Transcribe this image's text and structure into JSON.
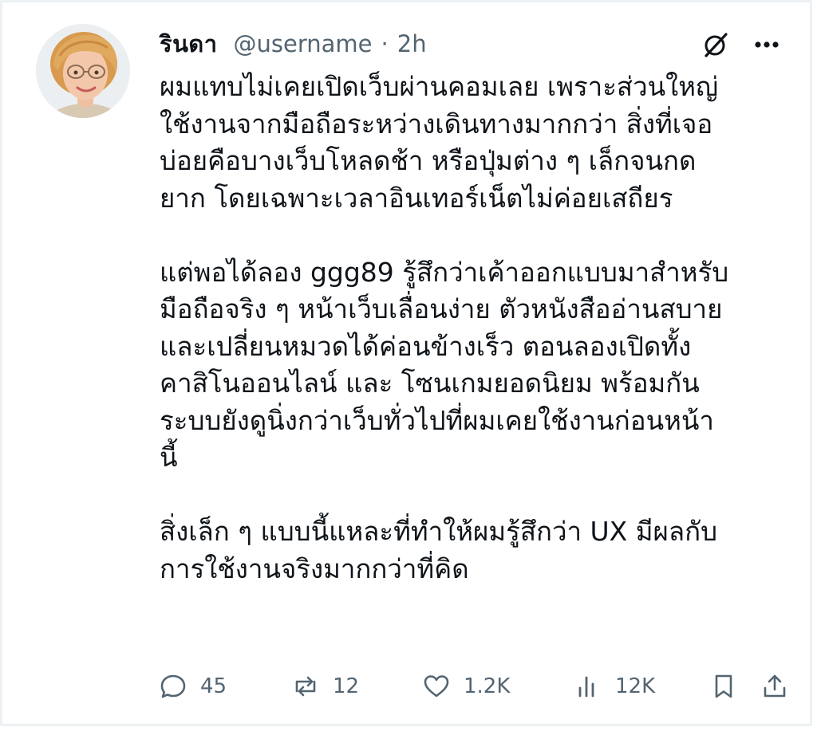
{
  "user": {
    "display_name": "รินดา",
    "handle": "@username",
    "separator": "·",
    "time": "2h"
  },
  "header_icons": [
    "grok-icon",
    "more-icon"
  ],
  "tweet": {
    "paragraphs": [
      [
        "ผมแทบไม่เคยเปิดเว็บผ่านคอมเลย เพราะส่วนใหญ่",
        "ใช้งานจากมือถือระหว่างเดินทางมากกว่า สิ่งที่เจอ",
        "บ่อยคือบางเว็บโหลดช้า หรือปุ่มต่าง ๆ เล็กจนกด",
        "ยาก โดยเฉพาะเวลาอินเทอร์เน็ตไม่ค่อยเสถียร"
      ],
      [
        "แต่พอได้ลอง ggg89 รู้สึกว่าเค้าออกแบบมาสำหรับ",
        "มือถือจริง ๆ หน้าเว็บเลื่อนง่าย ตัวหนังสืออ่านสบาย",
        "และเปลี่ยนหมวดได้ค่อนข้างเร็ว ตอนลองเปิดทั้ง",
        "คาสิโนออนไลน์ และ โซนเกมยอดนิยม พร้อมกัน",
        "ระบบยังดูนิ่งกว่าเว็บทั่วไปที่ผมเคยใช้งานก่อนหน้า",
        "นี้"
      ],
      [
        "สิ่งเล็ก ๆ แบบนี้แหละที่ทำให้ผมรู้สึกว่า UX มีผลกับ",
        "การใช้งานจริงมากกว่าที่คิด"
      ]
    ]
  },
  "actions": {
    "reply": {
      "icon": "reply-icon",
      "count": "45"
    },
    "retweet": {
      "icon": "retweet-icon",
      "count": "12"
    },
    "like": {
      "icon": "like-icon",
      "count": "1.2K"
    },
    "views": {
      "icon": "views-icon",
      "count": "12K"
    },
    "bookmark": {
      "icon": "bookmark-icon"
    },
    "share": {
      "icon": "share-icon"
    }
  },
  "colors": {
    "text_primary": "#0f1419",
    "text_secondary": "#536471",
    "border": "#eef1f3"
  }
}
